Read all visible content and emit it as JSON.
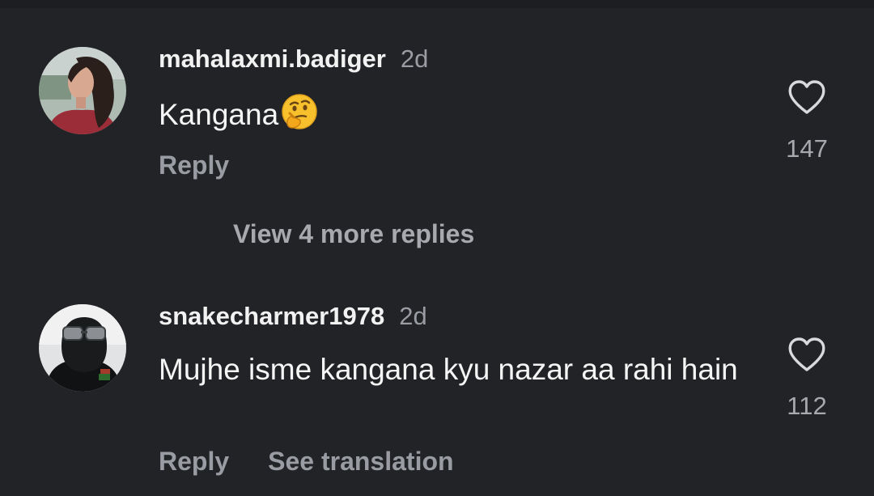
{
  "comments": [
    {
      "username": "mahalaxmi.badiger",
      "timestamp": "2d",
      "text": "Kangana",
      "emoji": "thinking-face",
      "likes": "147",
      "reply_label": "Reply"
    },
    {
      "username": "snakecharmer1978",
      "timestamp": "2d",
      "text": "Mujhe isme kangana kyu nazar aa rahi hain",
      "likes": "112",
      "reply_label": "Reply",
      "translate_label": "See translation"
    }
  ],
  "view_more_replies": "View 4 more replies",
  "colors": {
    "background": "#222326",
    "text_primary": "#f5f5f5",
    "text_secondary": "#9a9ca3",
    "heart_outline": "#d8d9dc"
  },
  "icons": {
    "like": "heart-outline-icon",
    "emoji": "thinking-face-emoji"
  }
}
